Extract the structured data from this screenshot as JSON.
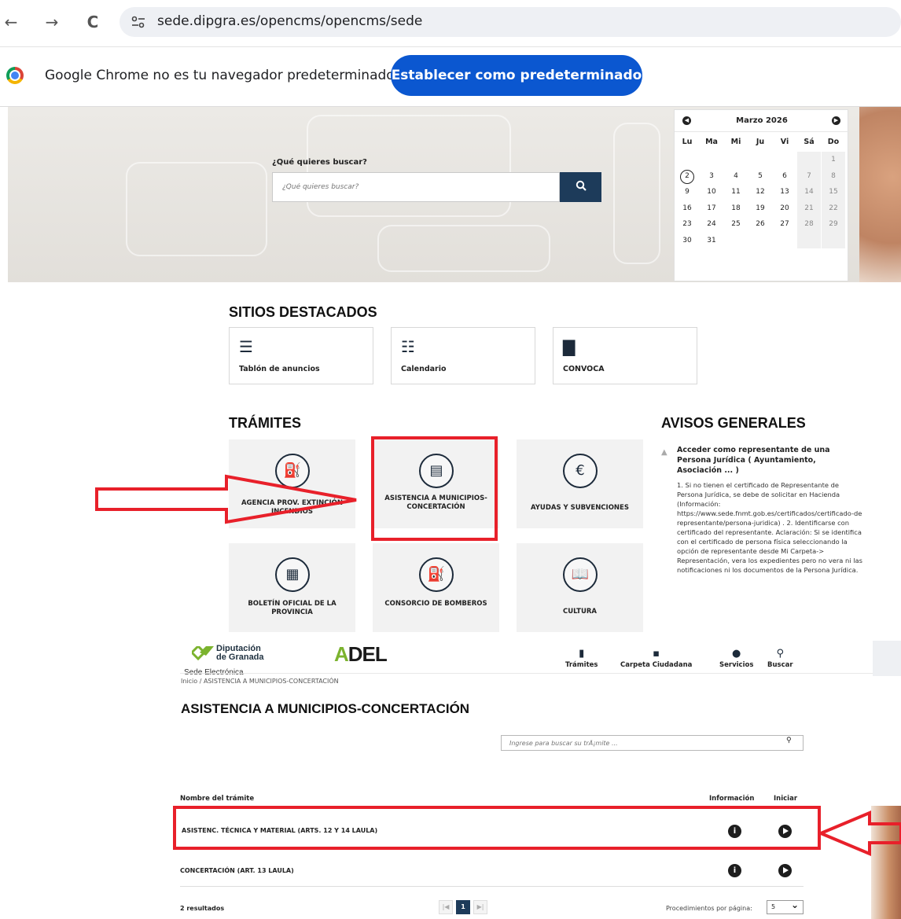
{
  "browser": {
    "url": "sede.dipgra.es/opencms/opencms/sede",
    "back": "←",
    "forward": "→",
    "reload": "C"
  },
  "infobar": {
    "message": "Google Chrome no es tu navegador predeterminado",
    "button": "Establecer como predeterminado"
  },
  "hero": {
    "search_label": "¿Qué quieres buscar?",
    "search_placeholder": "¿Qué quieres buscar?"
  },
  "calendar": {
    "month": "Marzo 2026",
    "weekdays": [
      "Lu",
      "Ma",
      "Mi",
      "Ju",
      "Vi",
      "Sá",
      "Do"
    ],
    "weeks": [
      [
        "",
        "",
        "",
        "",
        "",
        "",
        "1"
      ],
      [
        "2",
        "3",
        "4",
        "5",
        "6",
        "7",
        "8"
      ],
      [
        "9",
        "10",
        "11",
        "12",
        "13",
        "14",
        "15"
      ],
      [
        "16",
        "17",
        "18",
        "19",
        "20",
        "21",
        "22"
      ],
      [
        "23",
        "24",
        "25",
        "26",
        "27",
        "28",
        "29"
      ],
      [
        "30",
        "31",
        "",
        "",
        "",
        "",
        ""
      ]
    ],
    "today": "2"
  },
  "sitios": {
    "title": "SITIOS DESTACADOS",
    "items": [
      {
        "label": "Tablón de anuncios",
        "icon": "list-alt-icon"
      },
      {
        "label": "Calendario",
        "icon": "list-icon"
      },
      {
        "label": "CONVOCA",
        "icon": "file-icon"
      }
    ]
  },
  "tramites": {
    "title": "TRÁMITES",
    "items": [
      {
        "label": "AGENCIA PROV. EXTINCIÓN INCENDIOS",
        "icon": "fire-extinguisher-icon"
      },
      {
        "label": "ASISTENCIA A MUNICIPIOS-CONCERTACIÓN",
        "icon": "book-icon"
      },
      {
        "label": "AYUDAS Y SUBVENCIONES",
        "icon": "euro-icon"
      },
      {
        "label": "BOLETÍN OFICIAL DE LA PROVINCIA",
        "icon": "file-icon"
      },
      {
        "label": "CONSORCIO DE BOMBEROS",
        "icon": "fire-extinguisher-icon"
      },
      {
        "label": "CULTURA",
        "icon": "open-book-icon"
      }
    ]
  },
  "avisos": {
    "title": "AVISOS GENERALES",
    "item_title": "Acceder como representante de una Persona Jurídica ( Ayuntamiento, Asociación ... )",
    "item_body": "1. Si no tienen el certificado de Representante de Persona Jurídica, se debe de solicitar en Hacienda (Información: https://www.sede.fnmt.gob.es/certificados/certificado-de-representante/persona-juridica) . 2. Identificarse con certificado del representante. Aclaración: Si se identifica con el certificado de persona física seleccionando la opción de representante desde Mi Carpeta-> Representación, vera los expedientes pero no vera ni las notificaciones ni los documentos de la Persona Jurídica."
  },
  "site_header": {
    "logo_line1": "Diputación",
    "logo_line2": "de Granada",
    "logo_sub": "Sede Electrónica",
    "adel_a": "A",
    "adel_rest": "DEL",
    "nav": [
      {
        "label": "Trámites",
        "icon": "folder-icon"
      },
      {
        "label": "Carpeta Ciudadana",
        "icon": "id-card-icon"
      },
      {
        "label": "Servicios",
        "icon": "info-icon"
      },
      {
        "label": "Buscar",
        "icon": "search-icon"
      }
    ]
  },
  "page": {
    "breadcrumb": "Inicio  /  ASISTENCIA A MUNICIPIOS-CONCERTACIÓN",
    "title": "ASISTENCIA A MUNICIPIOS-CONCERTACIÓN",
    "search_placeholder": "Ingrese para buscar su trÃ¡mite ...",
    "columns": {
      "name": "Nombre del trámite",
      "info": "Información",
      "start": "Iniciar"
    },
    "rows": [
      {
        "name": "ASISTENC. TÉCNICA Y MATERIAL (ARTS. 12 Y 14 LAULA)"
      },
      {
        "name": "CONCERTACIÓN (ART. 13 LAULA)"
      }
    ],
    "results": "2 resultados",
    "pagination": {
      "first": "|◀",
      "current": "1",
      "last": "▶|"
    },
    "per_page_label": "Procedimientos por página:",
    "per_page_value": "5"
  },
  "annotation_color": "#e8202a"
}
